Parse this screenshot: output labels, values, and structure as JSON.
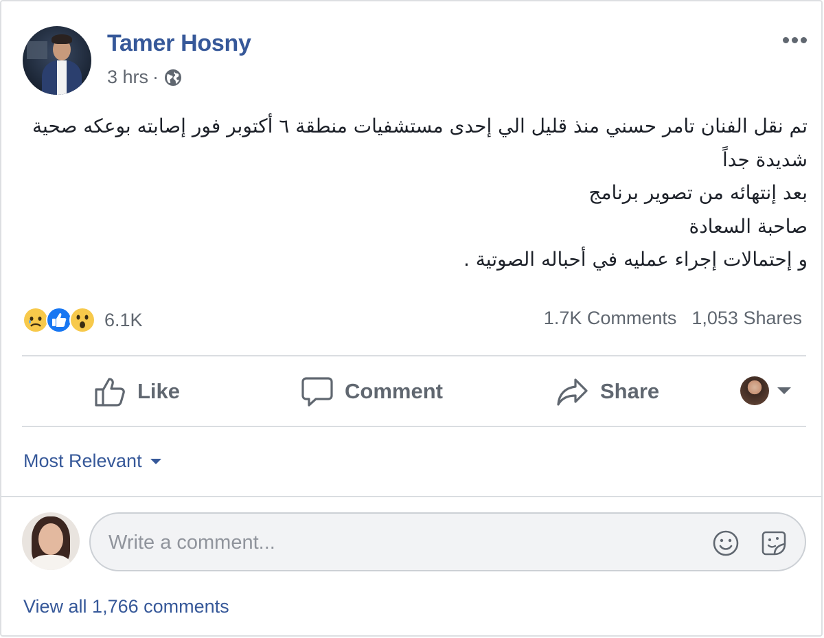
{
  "post": {
    "author": "Tamer Hosny",
    "timestamp": "3 hrs",
    "separator": "·",
    "privacy_icon": "globe-icon",
    "text_lines": [
      "تم نقل الفنان تامر حسني منذ قليل الي إحدى مستشفيات منطقة ٦ أكتوبر فور إصابته بوعكه صحية شديدة جداً",
      "بعد إنتهائه من تصوير برنامج",
      "صاحبة السعادة",
      "و إحتمالات إجراء عمليه في أحباله الصوتية ."
    ]
  },
  "reactions": {
    "icons": [
      "sad-reaction-icon",
      "like-reaction-icon",
      "wow-reaction-icon"
    ],
    "count": "6.1K"
  },
  "stats": {
    "comments": "1.7K Comments",
    "shares": "1,053 Shares"
  },
  "actions": {
    "like": "Like",
    "comment": "Comment",
    "share": "Share"
  },
  "sort": {
    "label": "Most Relevant"
  },
  "comment_box": {
    "placeholder": "Write a comment..."
  },
  "view_all": "View all 1,766 comments",
  "colors": {
    "link": "#365899",
    "secondary_text": "#606770",
    "like_blue": "#1877f2",
    "emoji_yellow": "#f7c94b",
    "input_bg": "#f2f3f5",
    "divider": "#dadde1"
  }
}
